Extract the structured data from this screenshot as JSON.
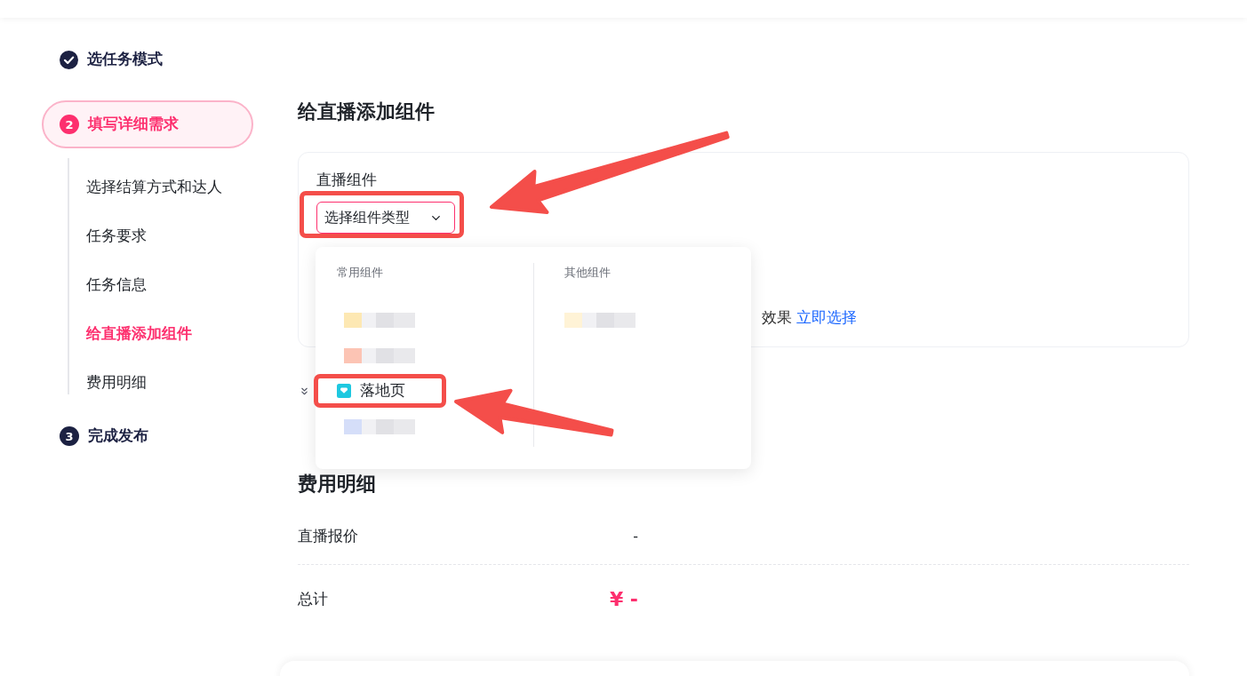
{
  "sidebar": {
    "steps": [
      {
        "label": "选任务模式",
        "completed": true,
        "selected": false
      },
      {
        "label": "填写详细需求",
        "number": "2",
        "completed": false,
        "selected": true,
        "children": [
          {
            "label": "选择结算方式和达人",
            "selected": false
          },
          {
            "label": "任务要求",
            "selected": false
          },
          {
            "label": "任务信息",
            "selected": false
          },
          {
            "label": "给直播添加组件",
            "selected": true
          },
          {
            "label": "费用明细",
            "selected": false
          }
        ]
      },
      {
        "label": "完成发布",
        "number": "3",
        "completed": false,
        "selected": false
      }
    ]
  },
  "components_section": {
    "title": "给直播添加组件",
    "field_label": "直播组件",
    "select": {
      "placeholder": "选择组件类型",
      "expanded": true,
      "annotated": true
    },
    "hint": "效果",
    "hint_link": "立即选择",
    "dropdown": {
      "columns": [
        {
          "title": "常用组件",
          "items": [
            {
              "kind": "blurred",
              "color": "#fde8b3",
              "annotated": false
            },
            {
              "kind": "blurred",
              "color": "#fcc4b4",
              "annotated": false
            },
            {
              "kind": "option",
              "label": "落地页",
              "annotated": true
            },
            {
              "kind": "blurred",
              "color": "#d5def9",
              "annotated": false
            }
          ]
        },
        {
          "title": "其他组件",
          "items": [
            {
              "kind": "blurred",
              "color": "#fff3d6",
              "annotated": false
            }
          ]
        }
      ]
    }
  },
  "cost_section": {
    "title": "费用明细",
    "rows": [
      {
        "kind": "plain",
        "label": "直播报价",
        "value": "-"
      },
      {
        "kind": "total",
        "label": "总计",
        "value": "¥ -"
      }
    ]
  }
}
